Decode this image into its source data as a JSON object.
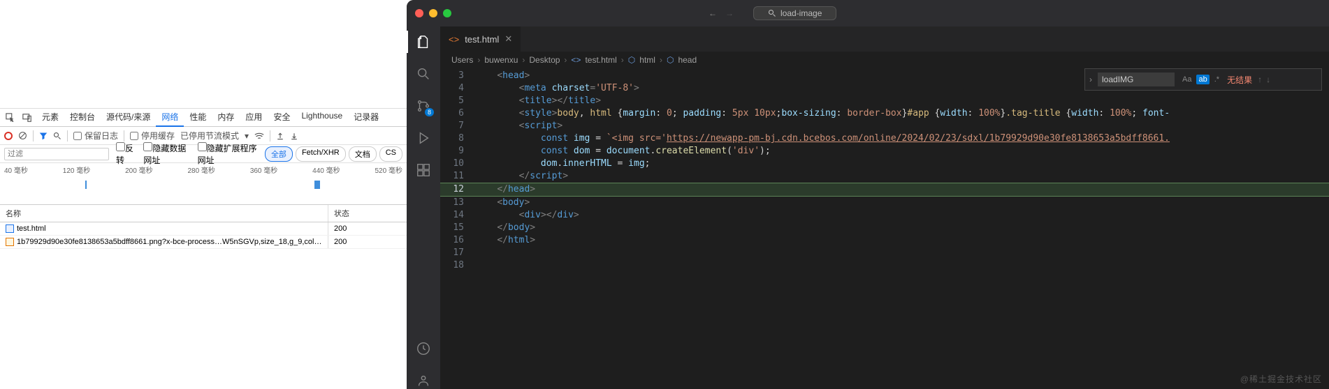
{
  "devtools": {
    "tabs": [
      "元素",
      "控制台",
      "源代码/来源",
      "网络",
      "性能",
      "内存",
      "应用",
      "安全",
      "Lighthouse",
      "记录器"
    ],
    "active_tab_index": 3,
    "toolbar": {
      "preserve_log": "保留日志",
      "disable_cache": "停用缓存",
      "throttle_label": "已停用节流模式"
    },
    "filterbar": {
      "placeholder": "过滤",
      "invert": "反转",
      "hide_data": "隐藏数据网址",
      "hide_ext": "隐藏扩展程序网址",
      "pills": [
        "全部",
        "Fetch/XHR",
        "文档",
        "CS"
      ],
      "active_pill": 0
    },
    "timeline_ticks": [
      "40 毫秒",
      "120 毫秒",
      "200 毫秒",
      "280 毫秒",
      "360 毫秒",
      "440 毫秒",
      "520 毫秒"
    ],
    "table": {
      "headers": {
        "name": "名称",
        "status": "状态"
      },
      "rows": [
        {
          "icon": "html",
          "name": "test.html",
          "status": "200"
        },
        {
          "icon": "img",
          "name": "1b79929d90e30fe8138653a5bdff8661.png?x-bce-process…W5nSGVp,size_18,g_9,color_…",
          "status": "200"
        }
      ]
    }
  },
  "vscode": {
    "titlebar_search": "load-image",
    "tab": {
      "filename": "test.html"
    },
    "breadcrumb": [
      "Users",
      "buwenxu",
      "Desktop",
      "test.html",
      "html",
      "head"
    ],
    "find": {
      "query": "loadIMG",
      "no_result": "无结果",
      "opt_aa": "Aa",
      "opt_ab": "ab",
      "opt_re": ".*"
    },
    "scm_badge": "8",
    "code_lines": [
      {
        "n": 3,
        "html": "<span class='tok-punc'>&lt;</span><span class='tok-tag'>head</span><span class='tok-punc'>&gt;</span>",
        "indent": 1
      },
      {
        "n": 4,
        "html": "<span class='tok-punc'>&lt;</span><span class='tok-tag'>meta</span> <span class='tok-attr'>charset</span><span class='tok-punc'>=</span><span class='tok-str'>'UTF-8'</span><span class='tok-punc'>&gt;</span>",
        "indent": 2
      },
      {
        "n": 5,
        "html": "<span class='tok-punc'>&lt;</span><span class='tok-tag'>title</span><span class='tok-punc'>&gt;&lt;/</span><span class='tok-tag'>title</span><span class='tok-punc'>&gt;</span>",
        "indent": 2
      },
      {
        "n": 6,
        "html": "<span class='tok-punc'>&lt;</span><span class='tok-tag'>style</span><span class='tok-punc'>&gt;</span><span class='tok-sel'>body</span><span class='tok-txt'>, </span><span class='tok-sel'>html</span><span class='tok-txt'> {</span><span class='tok-prop'>margin</span><span class='tok-txt'>: </span><span class='tok-val'>0</span><span class='tok-txt'>; </span><span class='tok-prop'>padding</span><span class='tok-txt'>: </span><span class='tok-val'>5px 10px</span><span class='tok-txt'>;</span><span class='tok-prop'>box-sizing</span><span class='tok-txt'>: </span><span class='tok-val'>border-box</span><span class='tok-txt'>}</span><span class='tok-sel'>#app</span><span class='tok-txt'> {</span><span class='tok-prop'>width</span><span class='tok-txt'>: </span><span class='tok-val'>100%</span><span class='tok-txt'>}</span><span class='tok-sel'>.tag-title</span><span class='tok-txt'> {</span><span class='tok-prop'>width</span><span class='tok-txt'>: </span><span class='tok-val'>100%</span><span class='tok-txt'>; </span><span class='tok-prop'>font-</span>",
        "indent": 2
      },
      {
        "n": 7,
        "html": "<span class='tok-punc'>&lt;</span><span class='tok-tag'>script</span><span class='tok-punc'>&gt;</span>",
        "indent": 2
      },
      {
        "n": 8,
        "html": "<span class='tok-kw'>const</span> <span class='tok-var'>img</span> <span class='tok-txt'>=</span> <span class='tok-str'>`&lt;img src='</span><span class='tok-url'>https://newapp-pm-bj.cdn.bcebos.com/online/2024/02/23/sdxl/1b79929d90e30fe8138653a5bdff8661.</span>",
        "indent": 3
      },
      {
        "n": 9,
        "html": "<span class='tok-kw'>const</span> <span class='tok-var'>dom</span> <span class='tok-txt'>=</span> <span class='tok-var'>document</span><span class='tok-txt'>.</span><span class='tok-fn'>createElement</span><span class='tok-txt'>(</span><span class='tok-str'>'div'</span><span class='tok-txt'>);</span>",
        "indent": 3
      },
      {
        "n": 10,
        "html": "<span class='tok-var'>dom</span><span class='tok-txt'>.</span><span class='tok-var'>innerHTML</span> <span class='tok-txt'>=</span> <span class='tok-var'>img</span><span class='tok-txt'>;</span>",
        "indent": 3
      },
      {
        "n": 11,
        "html": "<span class='tok-punc'>&lt;/</span><span class='tok-tag'>script</span><span class='tok-punc'>&gt;</span>",
        "indent": 2
      },
      {
        "n": 12,
        "html": "<span class='tok-punc'>&lt;/</span><span class='tok-tag'>head</span><span class='tok-punc'>&gt;</span>",
        "indent": 1,
        "hl": true
      },
      {
        "n": 13,
        "html": "<span class='tok-punc'>&lt;</span><span class='tok-tag'>body</span><span class='tok-punc'>&gt;</span>",
        "indent": 1
      },
      {
        "n": 14,
        "html": "<span class='tok-punc'>&lt;</span><span class='tok-tag'>div</span><span class='tok-punc'>&gt;&lt;/</span><span class='tok-tag'>div</span><span class='tok-punc'>&gt;</span>",
        "indent": 2
      },
      {
        "n": 15,
        "html": "<span class='tok-punc'>&lt;/</span><span class='tok-tag'>body</span><span class='tok-punc'>&gt;</span>",
        "indent": 1
      },
      {
        "n": 16,
        "html": "<span class='tok-punc'>&lt;/</span><span class='tok-tag'>html</span><span class='tok-punc'>&gt;</span>",
        "indent": 1
      },
      {
        "n": 17,
        "html": "",
        "indent": 0
      },
      {
        "n": 18,
        "html": "",
        "indent": 0
      }
    ]
  },
  "watermark": "@稀土掘金技术社区"
}
